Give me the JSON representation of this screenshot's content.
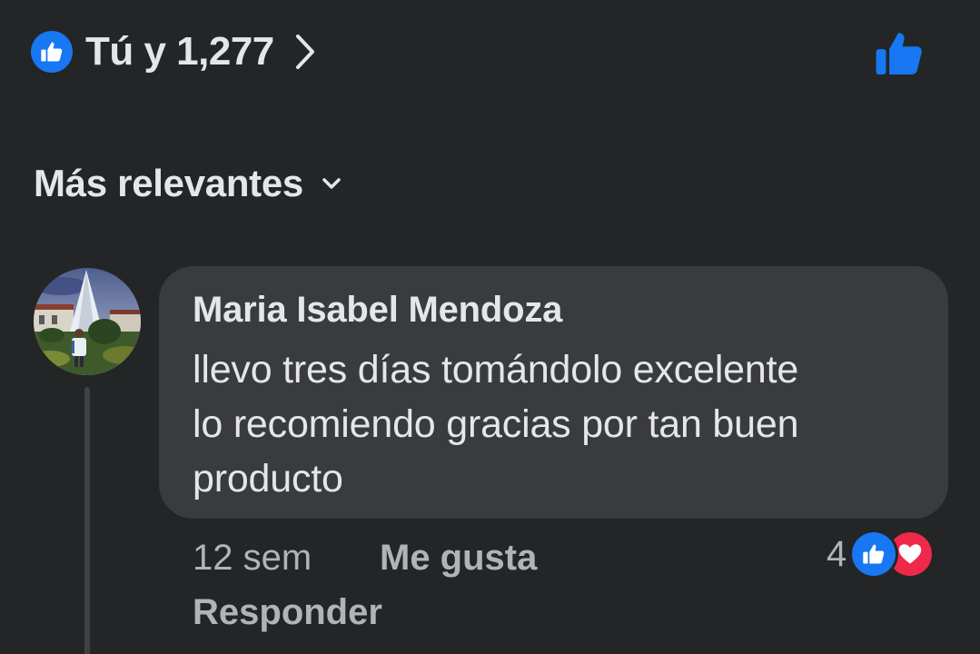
{
  "reaction_summary": {
    "text": "Tú y 1,277",
    "icon": "like-icon",
    "accent_color": "#1877f2"
  },
  "sort": {
    "label": "Más relevantes",
    "icon": "chevron-down-icon"
  },
  "comment": {
    "author": "Maria Isabel Mendoza",
    "text": "llevo tres días tomándolo excelente\nlo recomiendo gracias por tan buen\nproducto",
    "time": "12 sem",
    "like_label": "Me gusta",
    "reply_label": "Responder",
    "reaction_count": "4",
    "reactions": [
      "like-icon",
      "love-icon"
    ]
  },
  "colors": {
    "background": "#242526",
    "bubble": "#3a3b3c",
    "primary_text": "#e4e6eb",
    "secondary_text": "#b0b3b8",
    "like_blue": "#1877f2",
    "love_red": "#f02849"
  }
}
